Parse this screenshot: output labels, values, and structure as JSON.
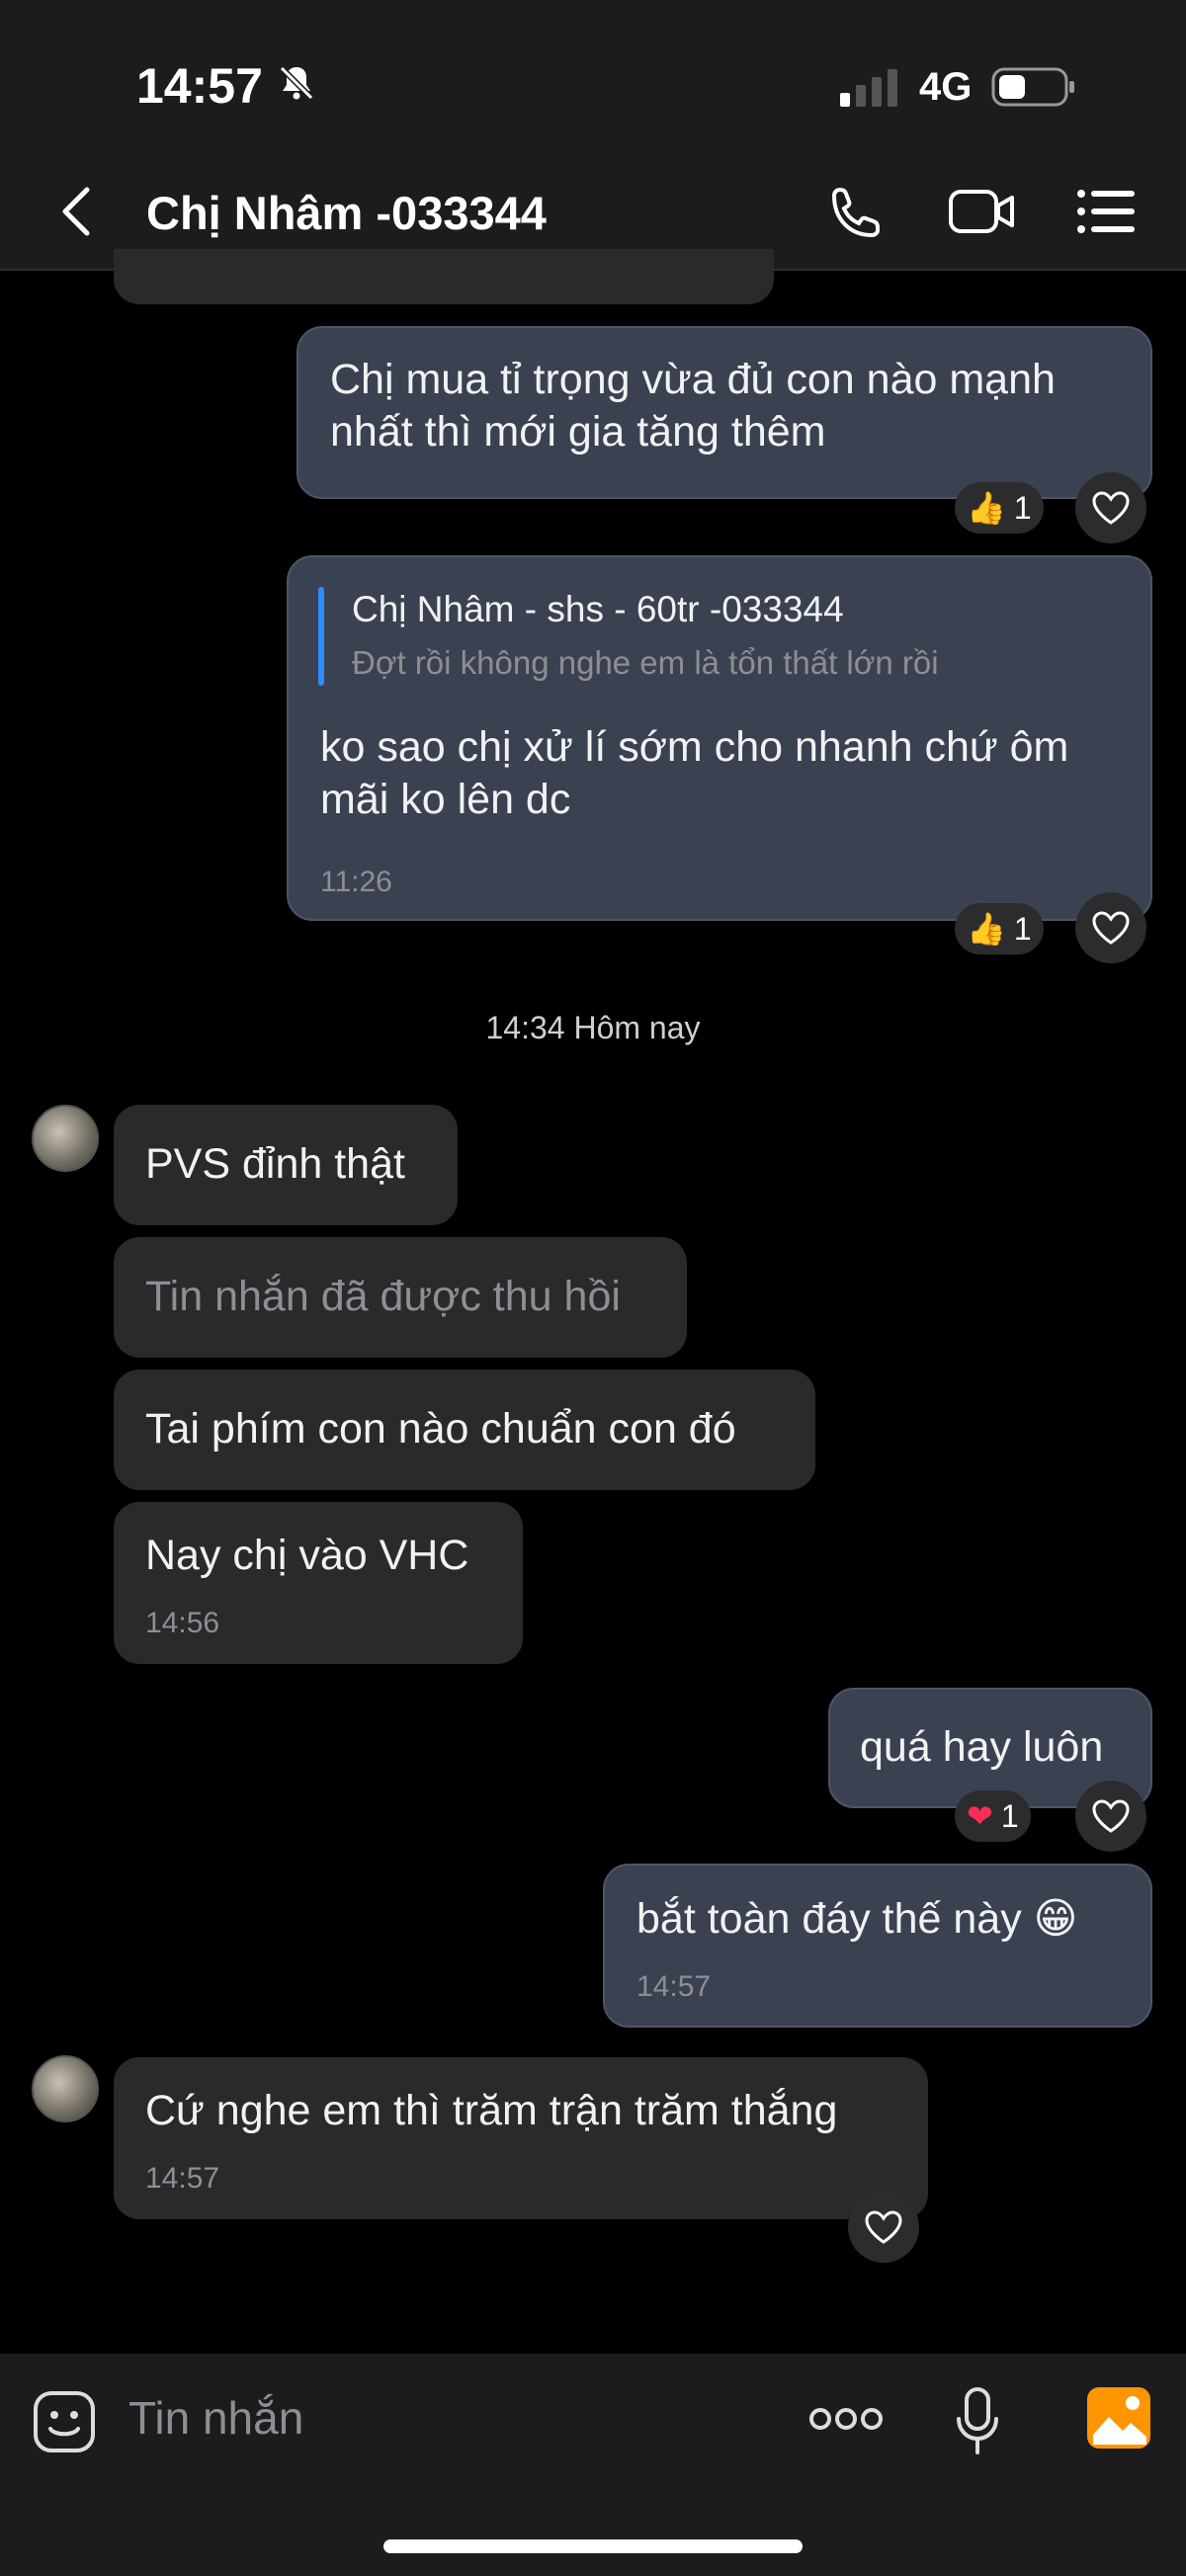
{
  "status": {
    "time": "14:57",
    "network": "4G"
  },
  "header": {
    "title": "Chị Nhâm -033344"
  },
  "messages": {
    "m1": {
      "text": "Chị mua tỉ trọng vừa đủ con nào mạnh nhất thì mới gia tăng thêm",
      "reaction_count": "1"
    },
    "m2": {
      "quote_author": "Chị Nhâm - shs - 60tr -033344",
      "quote_text": "Đợt rồi không nghe em là tổn thất lớn rồi",
      "text": "ko sao chị xử lí sớm cho nhanh chứ ôm mãi ko lên dc",
      "time": "11:26",
      "reaction_count": "1"
    },
    "separator": "14:34 Hôm nay",
    "m3": {
      "text": "PVS đỉnh thật"
    },
    "m4": {
      "text": "Tin nhắn đã được thu hồi"
    },
    "m5": {
      "text": "Tai phím con nào chuẩn con đó"
    },
    "m6": {
      "text": "Nay chị vào VHC",
      "time": "14:56"
    },
    "m7": {
      "text": "quá hay luôn",
      "reaction_count": "1"
    },
    "m8": {
      "text": "bắt toàn đáy thế này 😁",
      "time": "14:57"
    },
    "m9": {
      "text": "Cứ nghe em thì trăm trận trăm thắng",
      "time": "14:57"
    }
  },
  "input": {
    "placeholder": "Tin nhắn"
  },
  "colors": {
    "outgoing_bubble": "#3a4252",
    "incoming_bubble": "#2a2a2c",
    "accent": "#2f8bff",
    "gallery": "#ff9500"
  }
}
